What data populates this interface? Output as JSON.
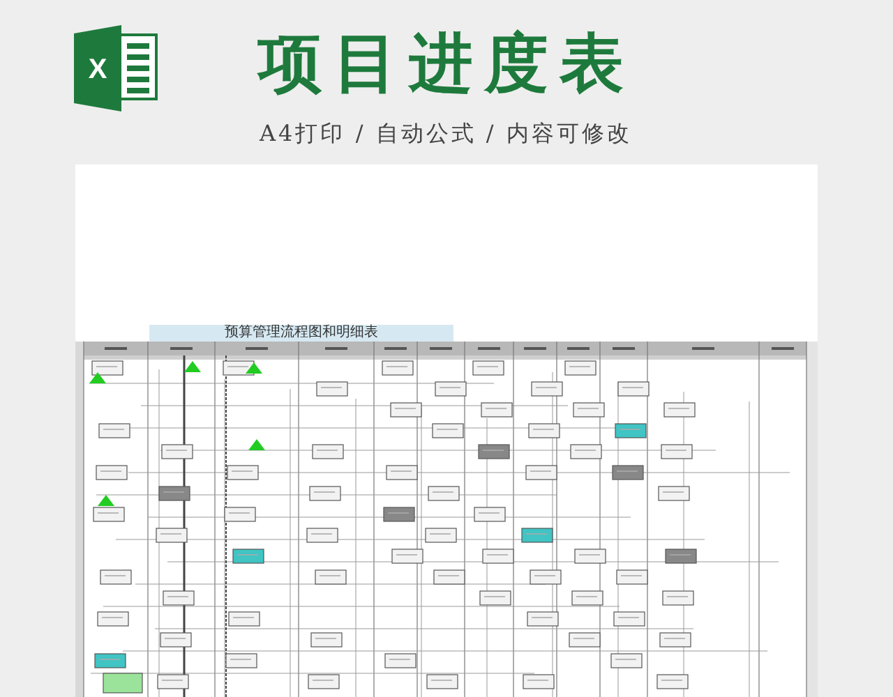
{
  "header": {
    "logo_letter": "X",
    "title": "项目进度表",
    "subtitle": "A4打印 / 自动公式 / 内容可修改"
  },
  "sheet": {
    "title": "预算管理流程图和明细表"
  }
}
